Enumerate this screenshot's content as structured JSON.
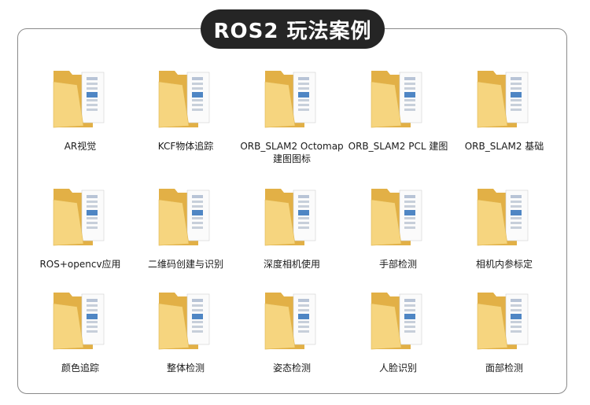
{
  "title": "ROS2 玩法案例",
  "folders": [
    {
      "label": "AR视觉"
    },
    {
      "label": "KCF物体追踪"
    },
    {
      "label": "ORB_SLAM2 Octomap建图图标"
    },
    {
      "label": "ORB_SLAM2 PCL 建图"
    },
    {
      "label": "ORB_SLAM2 基础"
    },
    {
      "label": "ROS+opencv应用"
    },
    {
      "label": "二维码创建与识别"
    },
    {
      "label": "深度相机使用"
    },
    {
      "label": "手部检测"
    },
    {
      "label": "相机内参标定"
    },
    {
      "label": "颜色追踪"
    },
    {
      "label": "整体检测"
    },
    {
      "label": "姿态检测"
    },
    {
      "label": "人脸识别"
    },
    {
      "label": "面部检测"
    }
  ],
  "colors": {
    "pill": "#252525",
    "folder_back": "#e8b84a",
    "folder_front": "#f7d784",
    "border": "#8a8a8a"
  }
}
